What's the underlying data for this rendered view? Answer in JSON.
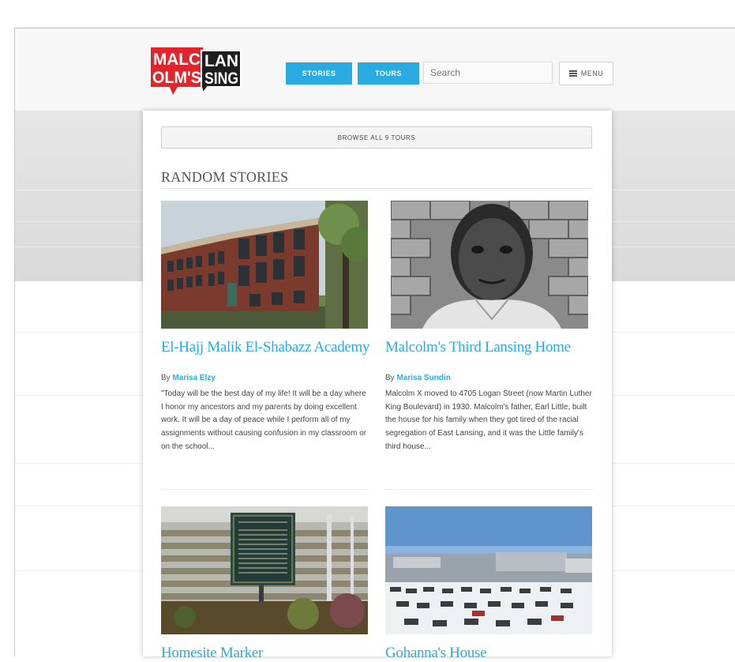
{
  "logo": {
    "row1_red": "MALC",
    "row1_dark": "LAN",
    "row2_red": "OLM'S",
    "row2_dark": "SING"
  },
  "nav": {
    "stories_label": "STORIES",
    "tours_label": "TOURS",
    "search_placeholder": "Search",
    "menu_label": "MENU"
  },
  "browse_label": "BROWSE ALL 9 TOURS",
  "section_title": "RANDOM STORIES",
  "stories": [
    {
      "title": "El-Hajj Malik El-Shabazz Academy",
      "by": "By ",
      "author": "Marisa Elzy",
      "excerpt": "\"Today will be the best day of my life! It will be a day where I honor my ancestors and my parents by doing excellent work. It will be a day of peace while I perform all of my assignments without causing confusion in my classroom or on the school..."
    },
    {
      "title": "Malcolm's Third Lansing Home",
      "by": "By ",
      "author": "Marisa Sundin",
      "excerpt": " Malcolm X moved to 4705 Logan Street (now Martin Luther King Boulevard) in 1930. Malcolm's father, Earl Little, built the house for his family when they got tired of the racial segregation of East Lansing, and it was the Little family's third house..."
    },
    {
      "title": "Homesite Marker"
    },
    {
      "title": "Gohanna's House"
    }
  ],
  "colors": {
    "accent": "#29abe2",
    "logo_red": "#e2242b",
    "logo_dark": "#1e1e1e"
  }
}
